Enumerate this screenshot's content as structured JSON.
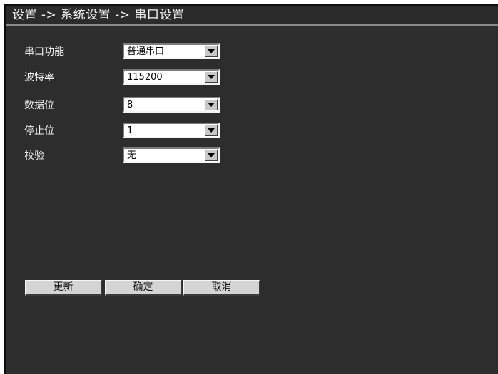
{
  "breadcrumb": "设置 -> 系统设置 -> 串口设置",
  "fields": [
    {
      "label": "串口功能",
      "value": "普通串口"
    },
    {
      "label": "波特率",
      "value": "115200"
    },
    {
      "label": "数据位",
      "value": "8"
    },
    {
      "label": "停止位",
      "value": "1"
    },
    {
      "label": "校验",
      "value": "无"
    }
  ],
  "buttons": {
    "refresh": "更新",
    "confirm": "确定",
    "cancel": "取消"
  },
  "icons": {
    "dropdown": "chevron-down-icon"
  },
  "colors": {
    "background": "#2d2d2d",
    "text": "#f0f0f0",
    "field_bg": "#ffffff",
    "button_bg": "#d4d4d4"
  }
}
